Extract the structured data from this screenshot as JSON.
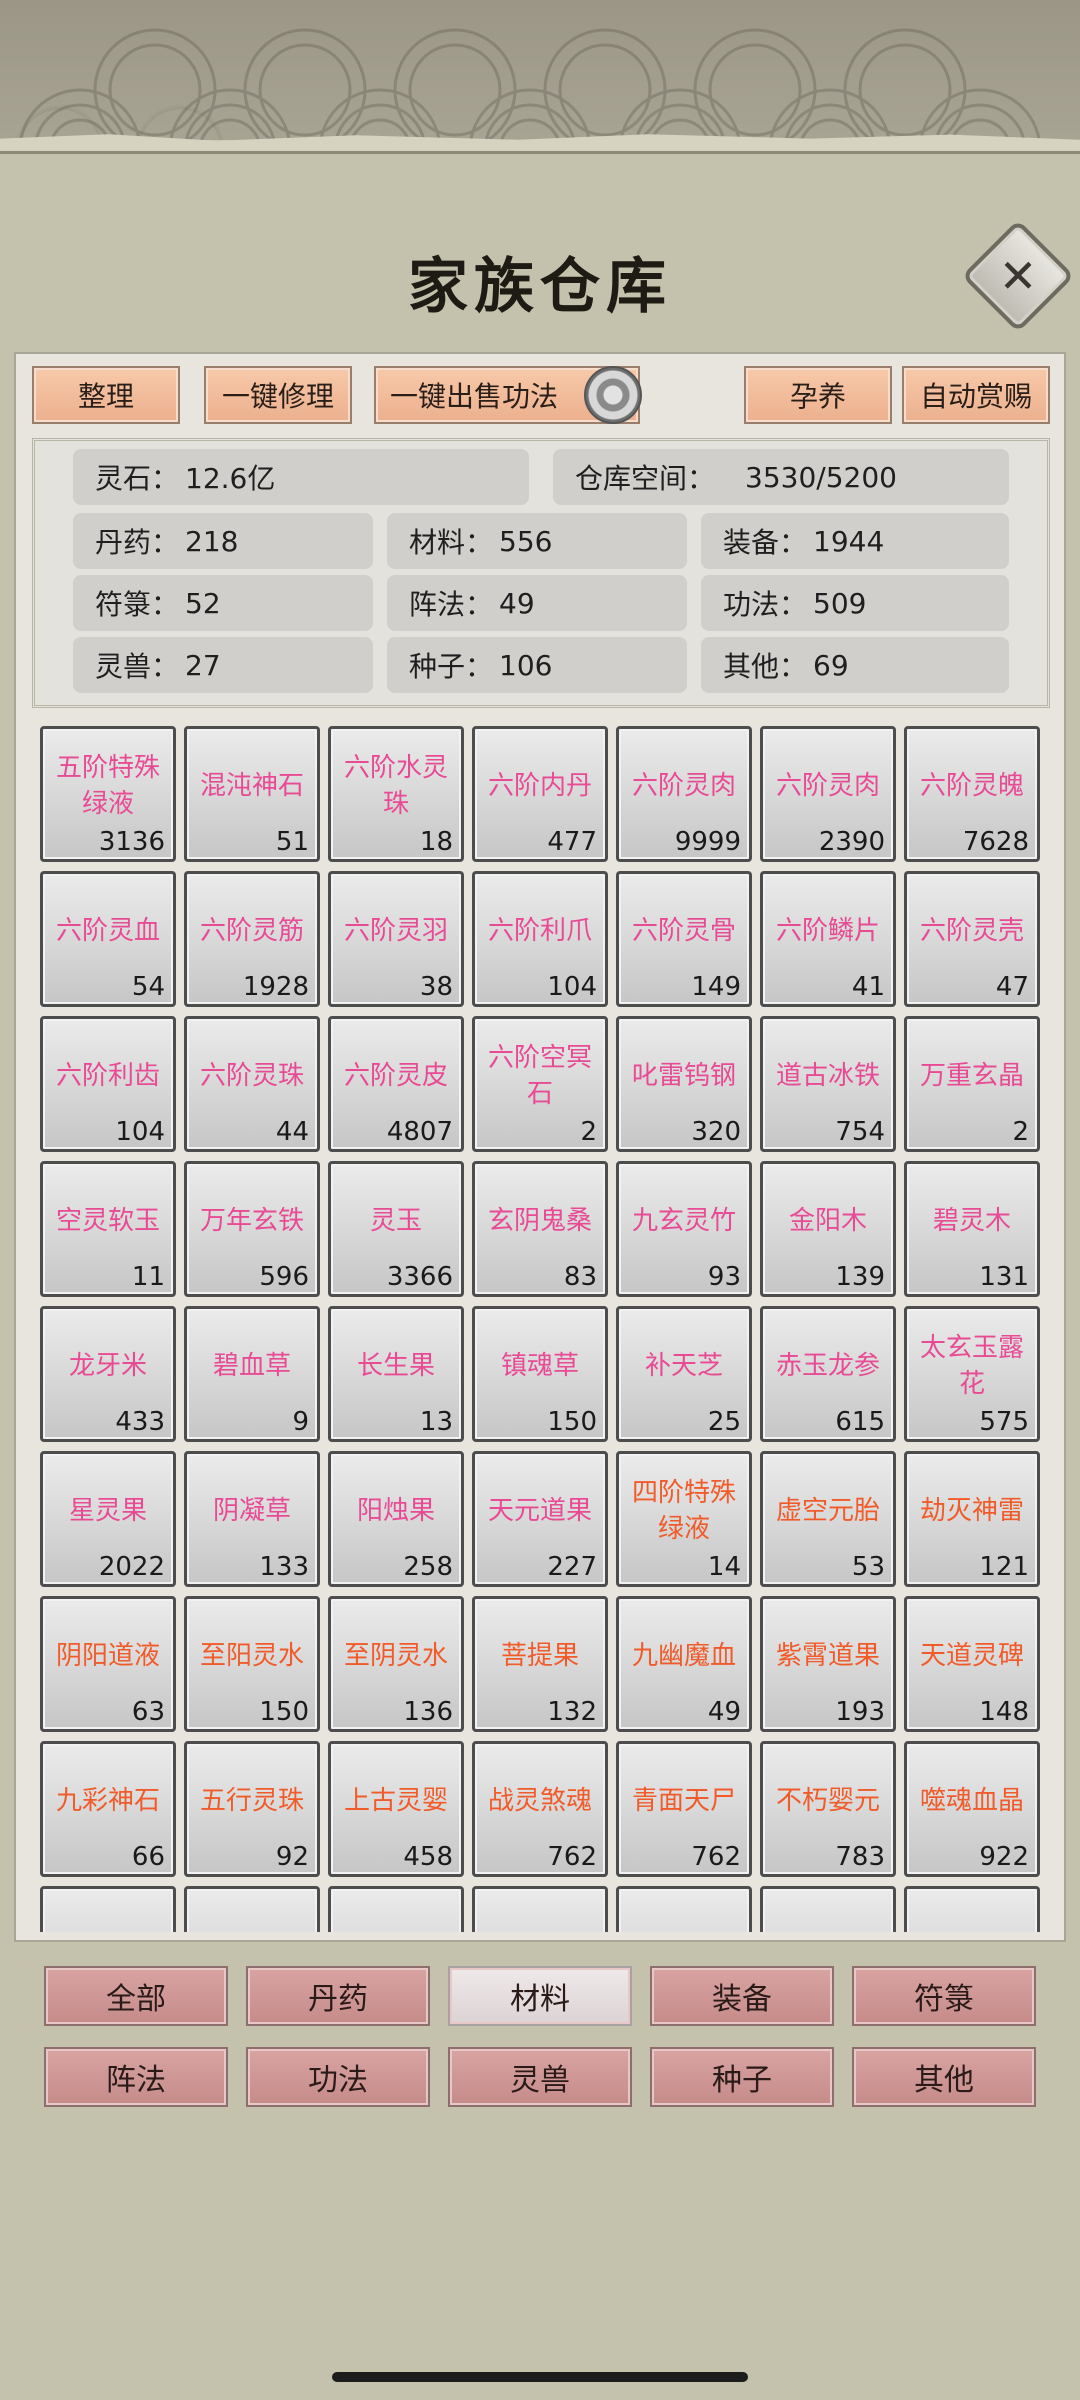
{
  "title": "家族仓库",
  "close_icon": "✕",
  "toolbar": {
    "sort": "整理",
    "repair": "一键修理",
    "sell": "一键出售功法",
    "nurture": "孕养",
    "auto_reward": "自动赏赐"
  },
  "stats": {
    "lingshi_label": "灵石：",
    "lingshi_value": "12.6亿",
    "space_label": "仓库空间：",
    "space_value": "3530/5200",
    "danyao_label": "丹药：",
    "danyao_value": "218",
    "cailiao_label": "材料：",
    "cailiao_value": "556",
    "zhuangbei_label": "装备：",
    "zhuangbei_value": "1944",
    "fulu_label": "符箓：",
    "fulu_value": "52",
    "zhenfa_label": "阵法：",
    "zhenfa_value": "49",
    "gongfa_label": "功法：",
    "gongfa_value": "509",
    "lingshou_label": "灵兽：",
    "lingshou_value": "27",
    "zhongzi_label": "种子：",
    "zhongzi_value": "106",
    "qita_label": "其他：",
    "qita_value": "69"
  },
  "colors": {
    "pink": "#e84b94",
    "orange": "#f15b2a"
  },
  "items": [
    {
      "name": "五阶特殊绿液",
      "count": "3136",
      "color": "pink"
    },
    {
      "name": "混沌神石",
      "count": "51",
      "color": "pink"
    },
    {
      "name": "六阶水灵珠",
      "count": "18",
      "color": "pink"
    },
    {
      "name": "六阶内丹",
      "count": "477",
      "color": "pink"
    },
    {
      "name": "六阶灵肉",
      "count": "9999",
      "color": "pink"
    },
    {
      "name": "六阶灵肉",
      "count": "2390",
      "color": "pink"
    },
    {
      "name": "六阶灵魄",
      "count": "7628",
      "color": "pink"
    },
    {
      "name": "六阶灵血",
      "count": "54",
      "color": "pink"
    },
    {
      "name": "六阶灵筋",
      "count": "1928",
      "color": "pink"
    },
    {
      "name": "六阶灵羽",
      "count": "38",
      "color": "pink"
    },
    {
      "name": "六阶利爪",
      "count": "104",
      "color": "pink"
    },
    {
      "name": "六阶灵骨",
      "count": "149",
      "color": "pink"
    },
    {
      "name": "六阶鳞片",
      "count": "41",
      "color": "pink"
    },
    {
      "name": "六阶灵壳",
      "count": "47",
      "color": "pink"
    },
    {
      "name": "六阶利齿",
      "count": "104",
      "color": "pink"
    },
    {
      "name": "六阶灵珠",
      "count": "44",
      "color": "pink"
    },
    {
      "name": "六阶灵皮",
      "count": "4807",
      "color": "pink"
    },
    {
      "name": "六阶空冥石",
      "count": "2",
      "color": "pink"
    },
    {
      "name": "叱雷钨钢",
      "count": "320",
      "color": "pink"
    },
    {
      "name": "道古冰铁",
      "count": "754",
      "color": "pink"
    },
    {
      "name": "万重玄晶",
      "count": "2",
      "color": "pink"
    },
    {
      "name": "空灵软玉",
      "count": "11",
      "color": "pink"
    },
    {
      "name": "万年玄铁",
      "count": "596",
      "color": "pink"
    },
    {
      "name": "灵玉",
      "count": "3366",
      "color": "pink"
    },
    {
      "name": "玄阴鬼桑",
      "count": "83",
      "color": "pink"
    },
    {
      "name": "九玄灵竹",
      "count": "93",
      "color": "pink"
    },
    {
      "name": "金阳木",
      "count": "139",
      "color": "pink"
    },
    {
      "name": "碧灵木",
      "count": "131",
      "color": "pink"
    },
    {
      "name": "龙牙米",
      "count": "433",
      "color": "pink"
    },
    {
      "name": "碧血草",
      "count": "9",
      "color": "pink"
    },
    {
      "name": "长生果",
      "count": "13",
      "color": "pink"
    },
    {
      "name": "镇魂草",
      "count": "150",
      "color": "pink"
    },
    {
      "name": "补天芝",
      "count": "25",
      "color": "pink"
    },
    {
      "name": "赤玉龙参",
      "count": "615",
      "color": "pink"
    },
    {
      "name": "太玄玉露花",
      "count": "575",
      "color": "pink"
    },
    {
      "name": "星灵果",
      "count": "2022",
      "color": "pink"
    },
    {
      "name": "阴凝草",
      "count": "133",
      "color": "pink"
    },
    {
      "name": "阳烛果",
      "count": "258",
      "color": "pink"
    },
    {
      "name": "天元道果",
      "count": "227",
      "color": "pink"
    },
    {
      "name": "四阶特殊绿液",
      "count": "14",
      "color": "orange"
    },
    {
      "name": "虚空元胎",
      "count": "53",
      "color": "orange"
    },
    {
      "name": "劫灭神雷",
      "count": "121",
      "color": "orange"
    },
    {
      "name": "阴阳道液",
      "count": "63",
      "color": "orange"
    },
    {
      "name": "至阳灵水",
      "count": "150",
      "color": "orange"
    },
    {
      "name": "至阴灵水",
      "count": "136",
      "color": "orange"
    },
    {
      "name": "菩提果",
      "count": "132",
      "color": "orange"
    },
    {
      "name": "九幽魔血",
      "count": "49",
      "color": "orange"
    },
    {
      "name": "紫霄道果",
      "count": "193",
      "color": "orange"
    },
    {
      "name": "天道灵碑",
      "count": "148",
      "color": "orange"
    },
    {
      "name": "九彩神石",
      "count": "66",
      "color": "orange"
    },
    {
      "name": "五行灵珠",
      "count": "92",
      "color": "orange"
    },
    {
      "name": "上古灵婴",
      "count": "458",
      "color": "orange"
    },
    {
      "name": "战灵煞魂",
      "count": "762",
      "color": "orange"
    },
    {
      "name": "青面天尸",
      "count": "762",
      "color": "orange"
    },
    {
      "name": "不朽婴元",
      "count": "783",
      "color": "orange"
    },
    {
      "name": "噬魂血晶",
      "count": "922",
      "color": "orange"
    }
  ],
  "tabs": [
    "全部",
    "丹药",
    "材料",
    "装备",
    "符箓",
    "阵法",
    "功法",
    "灵兽",
    "种子",
    "其他"
  ],
  "active_tab": "材料"
}
